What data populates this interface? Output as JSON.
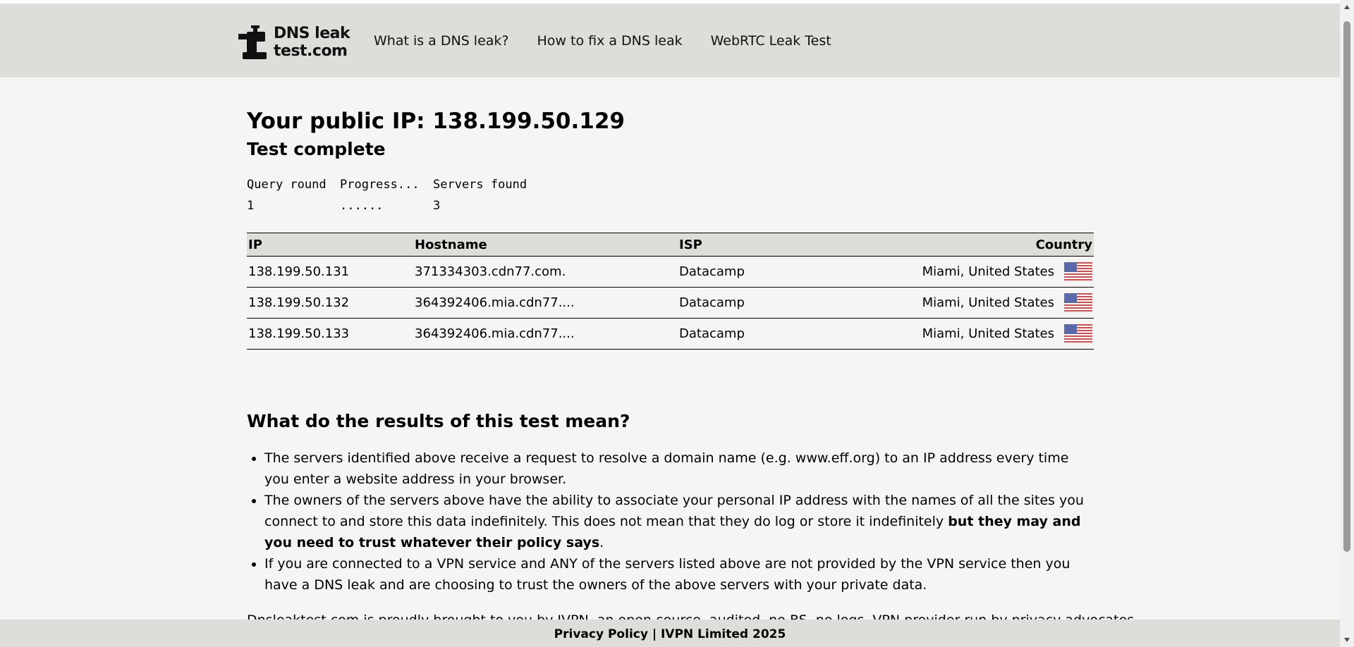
{
  "header": {
    "logo_line1": "DNS leak",
    "logo_line2": "test.com",
    "nav": [
      {
        "label": "What is a DNS leak?"
      },
      {
        "label": "How to fix a DNS leak"
      },
      {
        "label": "WebRTC Leak Test"
      }
    ]
  },
  "main": {
    "title": "Your public IP: 138.199.50.129",
    "status": "Test complete",
    "progress": {
      "headers": [
        "Query round",
        "Progress...",
        "Servers found"
      ],
      "row": [
        "1",
        "......",
        "3"
      ]
    },
    "table": {
      "headers": {
        "ip": "IP",
        "hostname": "Hostname",
        "isp": "ISP",
        "country": "Country"
      },
      "rows": [
        {
          "ip": "138.199.50.131",
          "hostname": "371334303.cdn77.com.",
          "isp": "Datacamp",
          "country": "Miami, United States",
          "flag": "us-flag-icon"
        },
        {
          "ip": "138.199.50.132",
          "hostname": "364392406.mia.cdn77....",
          "isp": "Datacamp",
          "country": "Miami, United States",
          "flag": "us-flag-icon"
        },
        {
          "ip": "138.199.50.133",
          "hostname": "364392406.mia.cdn77....",
          "isp": "Datacamp",
          "country": "Miami, United States",
          "flag": "us-flag-icon"
        }
      ]
    },
    "meaning_heading": "What do the results of this test mean?",
    "bullets": {
      "b1": "The servers identified above receive a request to resolve a domain name (e.g. www.eff.org) to an IP address every time you enter a website address in your browser.",
      "b2_text": "The owners of the servers above have the ability to associate your personal IP address with the names of all the sites you connect to and store this data indefinitely. This does not mean that they do log or store it indefinitely ",
      "b2_bold": "but they may and you need to trust whatever their policy says",
      "b2_end": ".",
      "b3": "If you are connected to a VPN service and ANY of the servers listed above are not provided by the VPN service then you have a DNS leak and are choosing to trust the owners of the above servers with your private data."
    },
    "outro": "Dnsleaktest.com is proudly brought to you by IVPN, an open-source, audited, no BS, no logs, VPN provider run by privacy advocates."
  },
  "footer": {
    "text": "Privacy Policy | IVPN Limited 2025"
  },
  "colors": {
    "header_bg": "#dfddd9",
    "page_bg": "#f5f5f5"
  }
}
